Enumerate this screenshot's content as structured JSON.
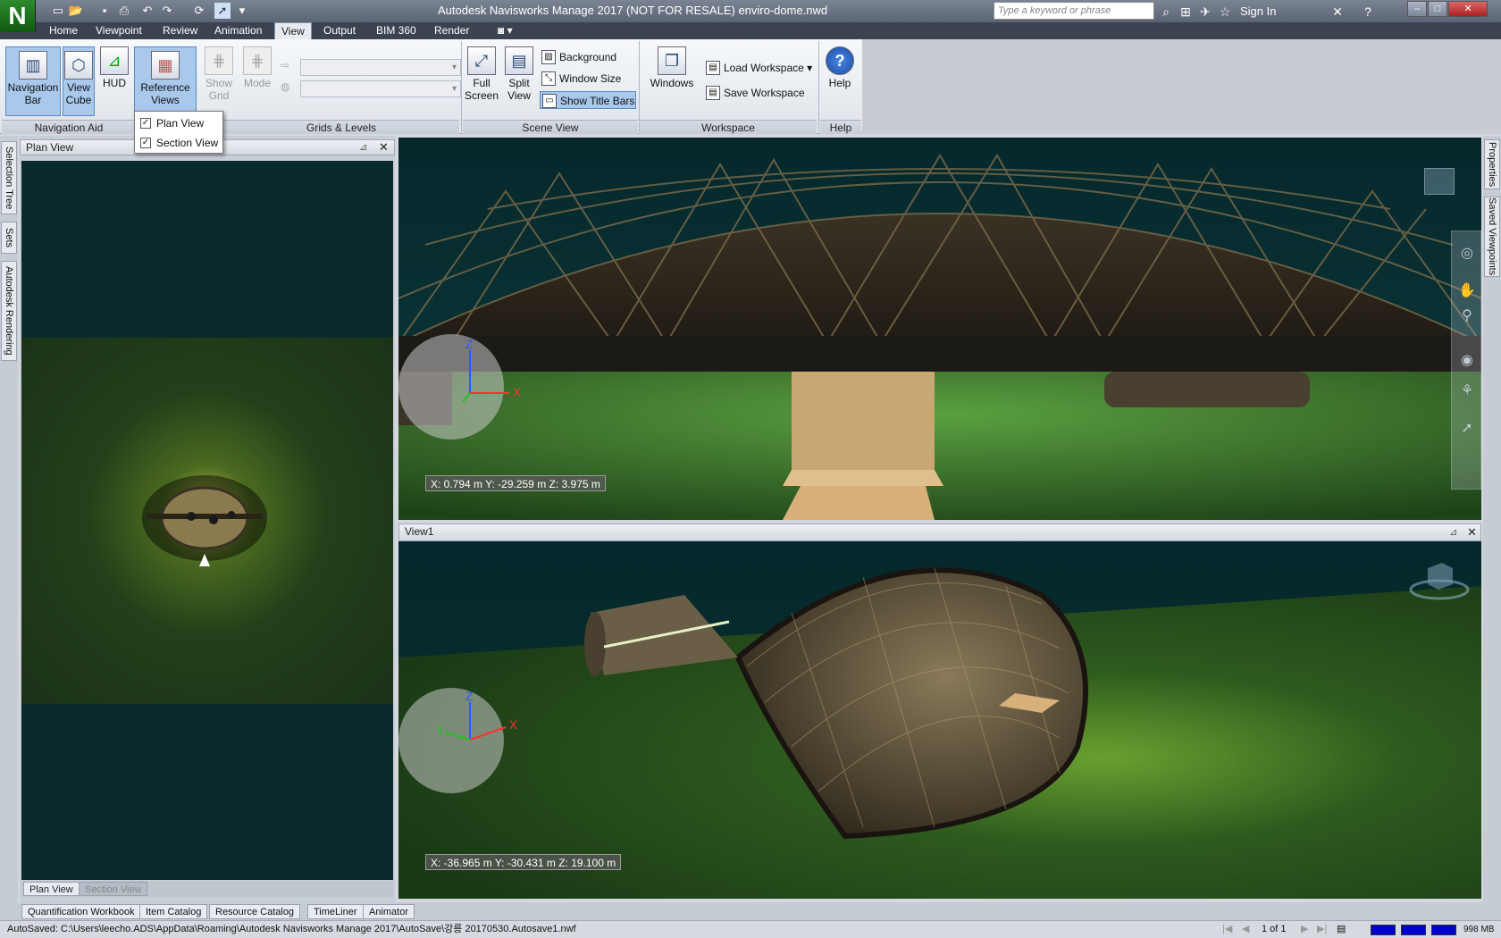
{
  "window": {
    "title": "Autodesk Navisworks Manage 2017 (NOT FOR RESALE)   enviro-dome.nwd"
  },
  "app_logo": "N",
  "search": {
    "placeholder": "Type a keyword or phrase"
  },
  "signin": "Sign In",
  "tabs": [
    {
      "label": "Home"
    },
    {
      "label": "Viewpoint"
    },
    {
      "label": "Review"
    },
    {
      "label": "Animation"
    },
    {
      "label": "View"
    },
    {
      "label": "Output"
    },
    {
      "label": "BIM 360"
    },
    {
      "label": "Render"
    }
  ],
  "ribbon": {
    "navigation_bar": "Navigation Bar",
    "view_cube": "View Cube",
    "hud": "HUD",
    "reference_views": "Reference Views",
    "show_grid": "Show Grid",
    "mode": "Mode",
    "full_screen": "Full Screen",
    "split_view": "Split View",
    "background": "Background",
    "window_size": "Window Size",
    "show_title_bars": "Show Title Bars",
    "windows": "Windows",
    "load_workspace": "Load Workspace",
    "save_workspace": "Save Workspace",
    "help": "Help",
    "panels": {
      "navigation_aids": "Navigation Aid",
      "grids_levels": "Grids & Levels",
      "scene_view": "Scene View",
      "workspace": "Workspace",
      "help": "Help"
    }
  },
  "dropdown": {
    "items": [
      {
        "label": "Plan View",
        "checked": true
      },
      {
        "label": "Section View",
        "checked": true
      }
    ]
  },
  "left_tabs": [
    "Selection Tree",
    "Sets",
    "Autodesk Rendering"
  ],
  "right_tabs": [
    "Properties",
    "Saved Viewpoints"
  ],
  "plan_panel": {
    "title": "Plan View",
    "tabs": [
      "Plan View",
      "Section View"
    ]
  },
  "view_top": {
    "coords": "X: 0.794 m  Y: -29.259 m  Z: 3.975 m"
  },
  "view1": {
    "title": "View1",
    "coords": "X: -36.965 m  Y: -30.431 m  Z: 19.100 m"
  },
  "bottom_tabs": [
    "Quantification Workbook",
    "Item Catalog",
    "Resource Catalog",
    "TimeLiner",
    "Animator"
  ],
  "status": {
    "autosave": "AutoSaved: C:\\Users\\leecho.ADS\\AppData\\Roaming\\Autodesk Navisworks Manage 2017\\AutoSave\\강릉 20170530.Autosave1.nwf",
    "page": "1 of 1",
    "memory": "998 MB"
  },
  "colors": {
    "accent": "#a8c8ec",
    "title": "#5a6474",
    "ground": "#2f5a1e"
  }
}
